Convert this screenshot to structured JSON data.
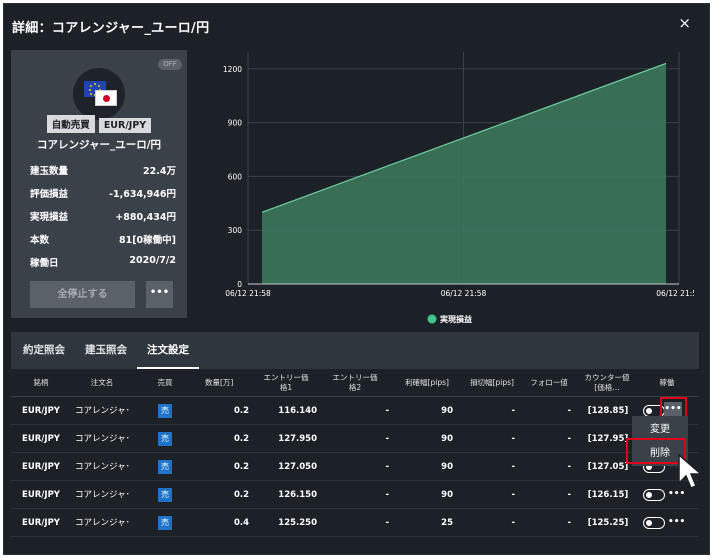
{
  "window": {
    "title": "詳細：コアレンジャー_ユーロ/円",
    "close": "×"
  },
  "summary": {
    "status_badge": "OFF",
    "icon": "eur-jpy-flags-icon",
    "tags": [
      "自動売買",
      "EUR/JPY"
    ],
    "name": "コアレンジャー_ユーロ/円",
    "stats": [
      {
        "label": "建玉数量",
        "value": "22.4万"
      },
      {
        "label": "評価損益",
        "value": "-1,634,946円"
      },
      {
        "label": "実現損益",
        "value": "+880,434円"
      },
      {
        "label": "本数",
        "value": "81[0稼働中]"
      },
      {
        "label": "稼働日",
        "value": "2020/7/2"
      }
    ],
    "stop_all_label": "全停止する",
    "more_label": "•••"
  },
  "chart_data": {
    "type": "area",
    "x": [
      "06/12 21:58",
      "06/12 21:59"
    ],
    "xtick_labels": [
      "06/12 21:58",
      "06/12 21:58",
      "06/12 21:59"
    ],
    "series": [
      {
        "name": "実現損益",
        "values": [
          400,
          1230
        ]
      }
    ],
    "yticks": [
      0,
      300,
      600,
      900,
      1200
    ],
    "ylim": [
      0,
      1260
    ],
    "grid": true,
    "legend_position": "bottom-center",
    "colors": {
      "fill": "#3d7a5f",
      "line": "#6fd0a0",
      "legend_dot": "#3ec58a"
    }
  },
  "tabs": [
    {
      "label": "約定照会",
      "active": false
    },
    {
      "label": "建玉照会",
      "active": false
    },
    {
      "label": "注文設定",
      "active": true
    }
  ],
  "table": {
    "columns": [
      "銘柄",
      "注文名",
      "売買",
      "数量[万]",
      "エントリー価格1",
      "エントリー価格2",
      "利確幅[pips]",
      "損切幅[pips]",
      "フォロー値",
      "カウンター値 [価格…",
      "稼働"
    ],
    "rows": [
      {
        "pair": "EUR/JPY",
        "name": "コアレンジャ･",
        "side": "売",
        "qty": "0.2",
        "entry1": "116.140",
        "entry2": "-",
        "take_profit": "90",
        "stop_loss": "-",
        "follow": "-",
        "counter": "[128.85]"
      },
      {
        "pair": "EUR/JPY",
        "name": "コアレンジャ･",
        "side": "売",
        "qty": "0.2",
        "entry1": "127.950",
        "entry2": "-",
        "take_profit": "90",
        "stop_loss": "-",
        "follow": "-",
        "counter": "[127.95]"
      },
      {
        "pair": "EUR/JPY",
        "name": "コアレンジャ･",
        "side": "売",
        "qty": "0.2",
        "entry1": "127.050",
        "entry2": "-",
        "take_profit": "90",
        "stop_loss": "-",
        "follow": "-",
        "counter": "[127.05]"
      },
      {
        "pair": "EUR/JPY",
        "name": "コアレンジャ･",
        "side": "売",
        "qty": "0.2",
        "entry1": "126.150",
        "entry2": "-",
        "take_profit": "90",
        "stop_loss": "-",
        "follow": "-",
        "counter": "[126.15]"
      },
      {
        "pair": "EUR/JPY",
        "name": "コアレンジャ･",
        "side": "売",
        "qty": "0.4",
        "entry1": "125.250",
        "entry2": "-",
        "take_profit": "25",
        "stop_loss": "-",
        "follow": "-",
        "counter": "[125.25]"
      }
    ],
    "row_more_label": "•••"
  },
  "context_menu": {
    "items": [
      "変更",
      "削除"
    ]
  },
  "colors": {
    "background": "#1c2127",
    "panel": "#3a4148",
    "accent_blue": "#1e72c8",
    "highlight_red": "#e0001a"
  }
}
